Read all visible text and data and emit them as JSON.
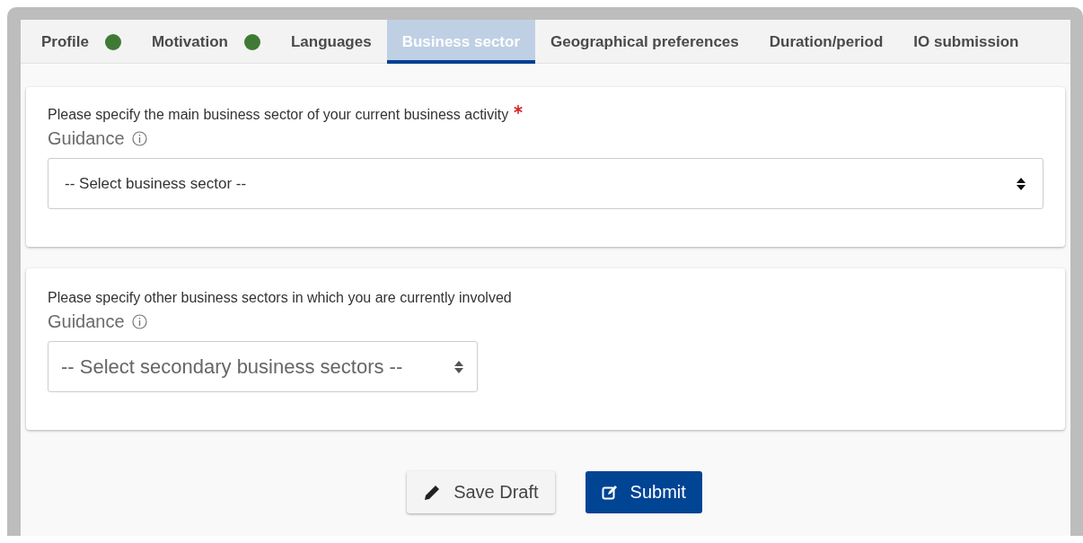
{
  "tabs": [
    {
      "label": "Profile",
      "selected": false,
      "completed": true
    },
    {
      "label": "Motivation",
      "selected": false,
      "completed": true
    },
    {
      "label": "Languages",
      "selected": false,
      "completed": false
    },
    {
      "label": "Business sector",
      "selected": true,
      "completed": false
    },
    {
      "label": "Geographical preferences",
      "selected": false,
      "completed": false
    },
    {
      "label": "Duration/period",
      "selected": false,
      "completed": false
    },
    {
      "label": "IO submission",
      "selected": false,
      "completed": false
    }
  ],
  "questions": [
    {
      "label": "Please specify the main business sector of your current business activity",
      "required": true,
      "guidance": "Guidance",
      "select": {
        "placeholder": "-- Select business sector --",
        "kind": "wide"
      }
    },
    {
      "label": "Please specify other business sectors in which you are currently involved",
      "required": false,
      "guidance": "Guidance",
      "select": {
        "placeholder": "-- Select secondary business sectors --",
        "kind": "compact"
      }
    }
  ],
  "buttons": [
    {
      "label": "Save Draft",
      "kind": "secondary"
    },
    {
      "label": "Submit",
      "kind": "primary"
    }
  ]
}
